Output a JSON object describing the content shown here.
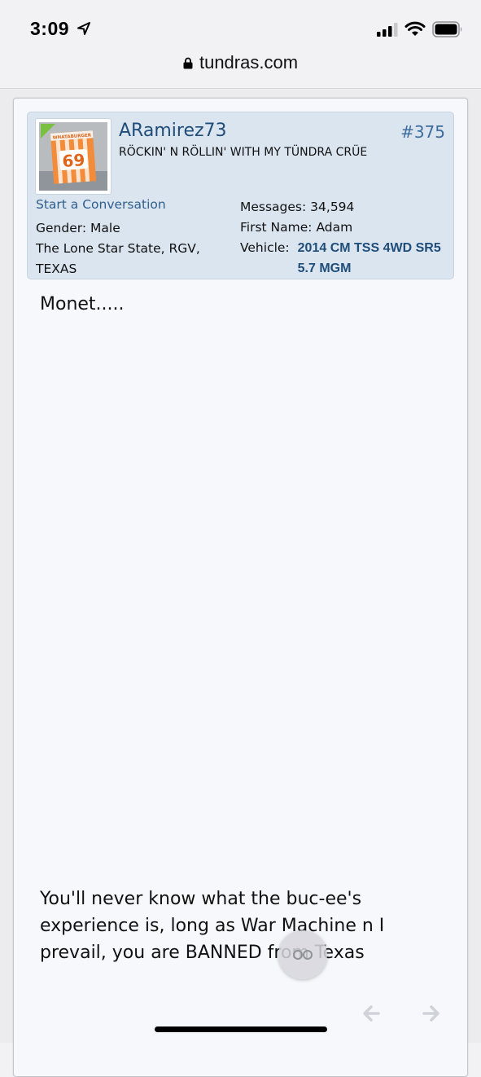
{
  "status_bar": {
    "time": "3:09",
    "icons": [
      "location-arrow-icon",
      "signal-bars-icon",
      "wifi-icon",
      "battery-icon"
    ]
  },
  "browser": {
    "url": "tundras.com",
    "icons": [
      "lock-icon"
    ]
  },
  "post": {
    "username": "ARamirez73",
    "user_title": "RÖCKIN' N RÖLLIN' WITH MY TÜNDRA CRÜE",
    "post_number": "#375",
    "start_conversation": "Start a Conversation",
    "gender_label": "Gender:",
    "gender_value": "Male",
    "location": "The Lone Star State, RGV, TEXAS",
    "messages_label": "Messages:",
    "messages_value": "34,594",
    "first_name_label": "First Name:",
    "first_name_value": "Adam",
    "vehicle_label": "Vehicle:",
    "vehicle_value": "2014 CM TSS 4WD SR5 5.7 MGM",
    "avatar_text": "69",
    "avatar_caption": "WHATABURGER",
    "body_line_1": "Monet.....",
    "body_line_2": "You'll never know what the buc-ee's experience is, long as War Machine n I prevail, you are BANNED from Texas"
  },
  "nav": {
    "icons": [
      "back-arrow-icon",
      "forward-arrow-icon"
    ]
  },
  "colors": {
    "username": "#1f4d7a",
    "user_info_bg": "#dbe5f0",
    "online_dot": "#7cc043"
  }
}
